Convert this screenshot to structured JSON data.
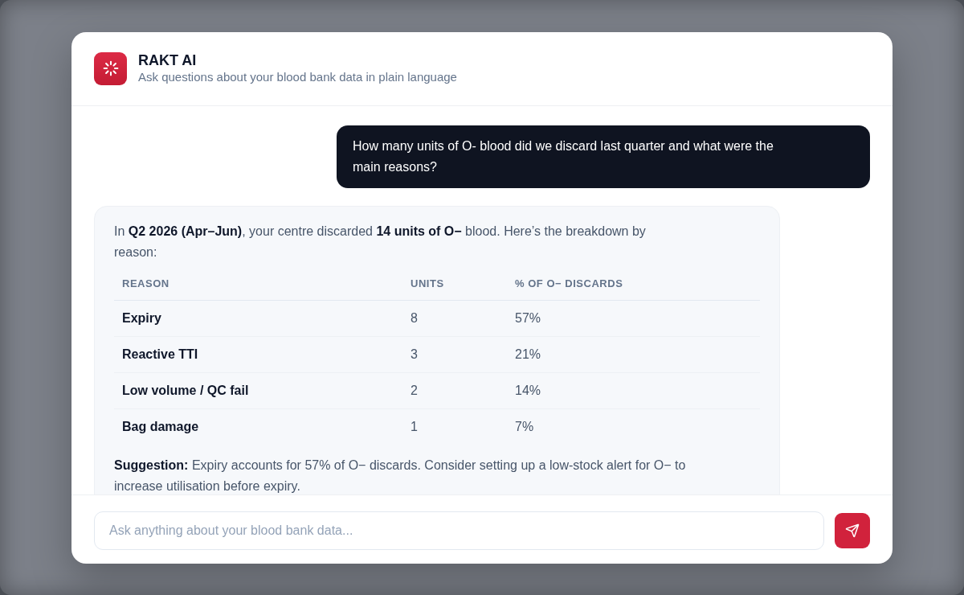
{
  "header": {
    "title": "RAKT AI",
    "subtitle": "Ask questions about your blood bank data in plain language"
  },
  "messages": [
    {
      "kind": "user",
      "text": "How many units of O- blood did we discard last quarter and what were the main reasons?"
    },
    {
      "kind": "assistant",
      "blocks": [
        {
          "kind": "paragraph",
          "text": "In **Q2 2026 (Apr–Jun)**, your centre discarded **14 units of O−** blood. Here’s the breakdown by reason:"
        },
        {
          "kind": "table",
          "columns": [
            "REASON",
            "UNITS",
            "% OF O− DISCARDS"
          ],
          "rows": [
            [
              "Expiry",
              "8",
              "57%"
            ],
            [
              "Reactive TTI",
              "3",
              "21%"
            ],
            [
              "Low volume / QC fail",
              "2",
              "14%"
            ],
            [
              "Bag damage",
              "1",
              "7%"
            ]
          ]
        },
        {
          "kind": "paragraph",
          "text": "**Suggestion:** Expiry accounts for 57% of O− discards. Consider setting up a low-stock alert for O− to increase utilisation before expiry."
        }
      ]
    }
  ],
  "composer": {
    "placeholder": "Ask anything about your blood bank data..."
  }
}
